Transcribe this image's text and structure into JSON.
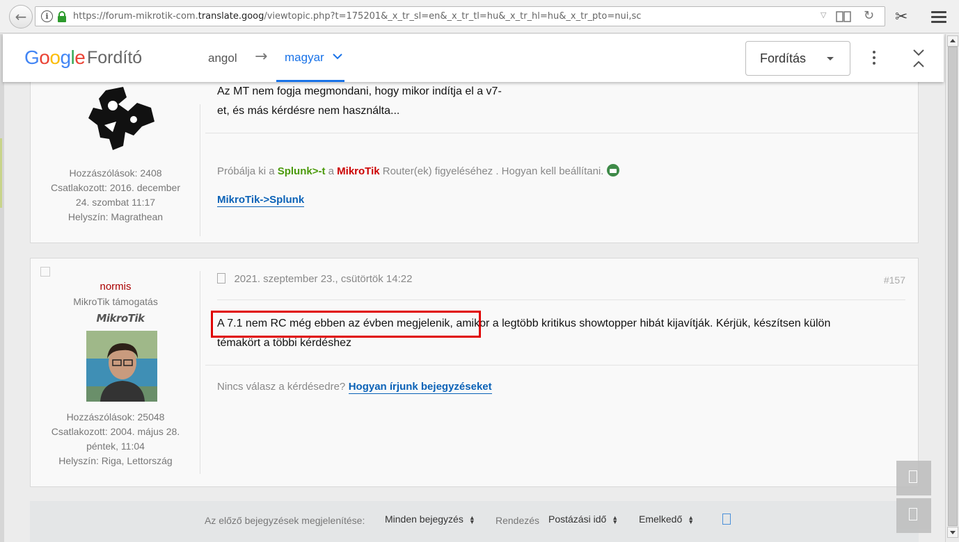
{
  "browser": {
    "url_prefix": "https://forum-mikrotik-com.",
    "url_domain": "translate.goog",
    "url_rest": "/viewtopic.php?t=175201&_x_tr_sl=en&_x_tr_tl=hu&_x_tr_hl=hu&_x_tr_pto=nui,sc"
  },
  "translate_bar": {
    "logo": [
      "G",
      "o",
      "o",
      "g",
      "l",
      "e"
    ],
    "product": "Fordító",
    "source_lang": "angol",
    "arrow": "→",
    "target_lang": "magyar",
    "mode": "Fordítás"
  },
  "post1": {
    "content_line1": "Az MT nem fogja megmondani, hogy mikor indítja el a v7-",
    "content_line2": "et, és más kérdésre nem használta...",
    "stats": {
      "posts": "Hozzászólások: 2408",
      "joined_1": "Csatlakozott: 2016. december",
      "joined_2": "24. szombat 11:17",
      "location": "Helyszín: Magrathean"
    },
    "signature": {
      "prefix": "Próbálja ki a",
      "splunk": "Splunk>-t",
      "mid": "a",
      "mikrotik": "MikroTik",
      "suffix": "Router(ek) figyeléséhez . Hogyan kell beállítani.",
      "link": "MikroTik->Splunk"
    }
  },
  "post2": {
    "username": "normis",
    "role": "MikroTik támogatás",
    "brand_badge": "MikroTik",
    "date": "2021. szeptember 23., csütörtök 14:22",
    "post_number": "#157",
    "content_highlight": "A 7.1 nem RC még ebben az évben megjelenik,",
    "content_rest": " amikor a legtöbb kritikus showtopper hibát kijavítják. Kérjük, készítsen külön",
    "content_line2": "témakört a többi kérdéshez",
    "stats": {
      "posts": "Hozzászólások: 25048",
      "joined_1": "Csatlakozott: 2004. május 28.",
      "joined_2": "péntek, 11:04",
      "location": "Helyszín: Riga, Lettország"
    },
    "footer_text": "Nincs válasz a kérdésedre?",
    "footer_link": "Hogyan írjunk bejegyzéseket"
  },
  "sortbar": {
    "display_label": "Az előző bejegyzések megjelenítése:",
    "display_value": "Minden bejegyzés",
    "sort_label": "Rendezés",
    "sort_value": "Postázási idő",
    "order_value": "Emelkedő"
  },
  "colors": {
    "highlight_box": "#e00000",
    "link": "#0b62b7",
    "username": "#aa0000"
  }
}
